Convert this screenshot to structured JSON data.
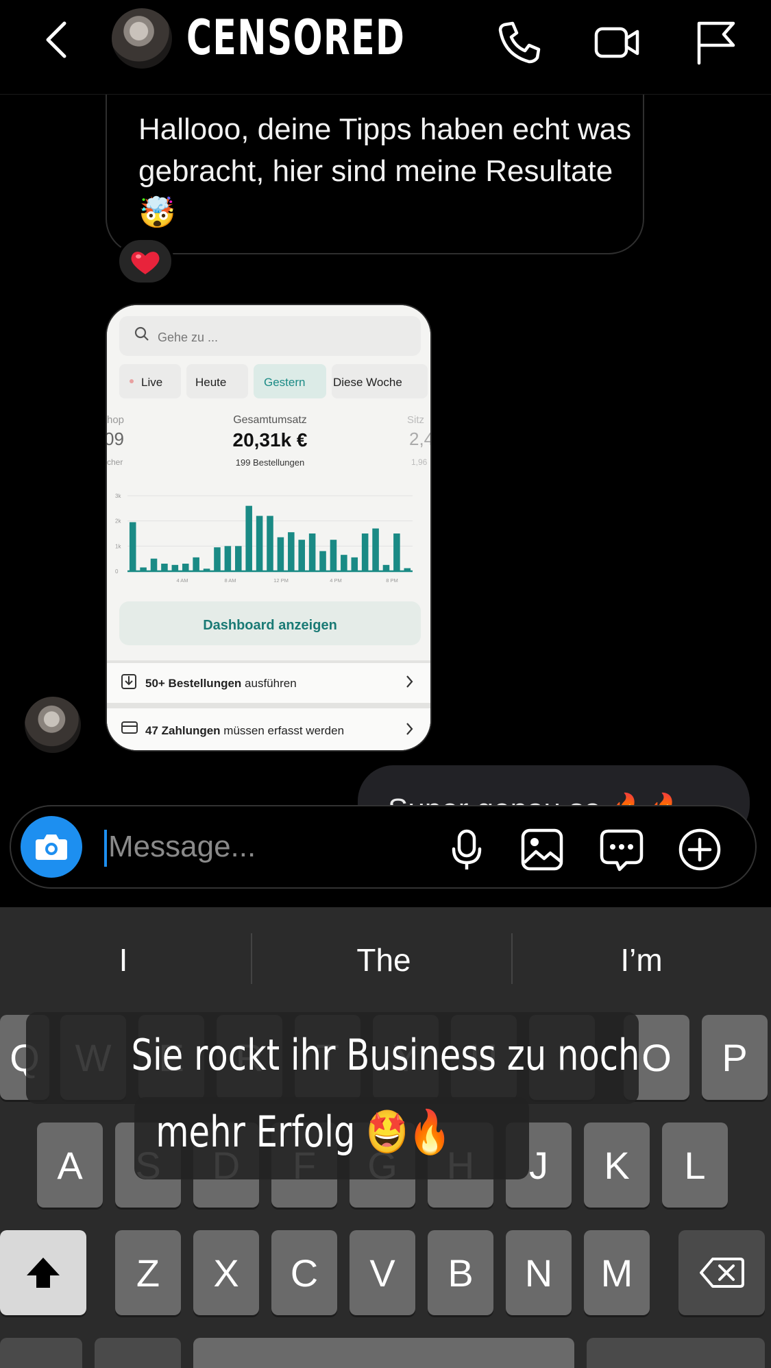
{
  "header": {
    "contact_name": "CENSORED",
    "icons": [
      "back-icon",
      "phone-icon",
      "video-icon",
      "flag-icon"
    ]
  },
  "messages": {
    "incoming_text": "Hallooo, deine Tipps haben echt was gebracht, hier sind meine Resultate 🤯",
    "reaction": "❤️",
    "outgoing_text_partial": "Super genau so 🔥🔥"
  },
  "shared_image": {
    "search_placeholder": "Gehe zu ...",
    "tabs": [
      "Live",
      "Heute",
      "Gestern",
      "Diese Woche"
    ],
    "active_tab": "Gestern",
    "left_metric": {
      "label": "hop",
      "value": "09",
      "sub": "cher"
    },
    "center_metric": {
      "label": "Gesamtumsatz",
      "value": "20,31k €",
      "sub": "199 Bestellungen"
    },
    "right_metric": {
      "label": "Sitz",
      "value": "2,4",
      "sub": "1,96"
    },
    "dashboard_button": "Dashboard anzeigen",
    "row1_bold": "50+ Bestellungen",
    "row1_rest": " ausführen",
    "row2_bold": "47 Zahlungen",
    "row2_rest": " müssen erfasst werden",
    "accent_color": "#1a8a85"
  },
  "chart_data": {
    "type": "bar",
    "ylabels": [
      "3k",
      "2k",
      "1k",
      "0"
    ],
    "xlabels": [
      "4 AM",
      "8 AM",
      "12 PM",
      "4 PM",
      "8 PM"
    ],
    "ylim": [
      0,
      3000
    ],
    "values": [
      1950,
      150,
      500,
      300,
      250,
      300,
      550,
      100,
      950,
      1000,
      1000,
      2600,
      2200,
      2200,
      1350,
      1550,
      1250,
      1500,
      800,
      1250,
      650,
      550,
      1500,
      1700,
      250,
      1500,
      120
    ],
    "color": "#1a8a85"
  },
  "composer": {
    "placeholder": "Message...",
    "icons": [
      "camera-icon",
      "microphone-icon",
      "gallery-icon",
      "sticker-icon",
      "plus-icon"
    ],
    "camera_color": "#1d8ff0"
  },
  "keyboard": {
    "suggestions": [
      "I",
      "The",
      "I’m"
    ],
    "row1": [
      "Q",
      "W",
      "E",
      "R",
      "T",
      "Y",
      "U",
      "I",
      "O",
      "P"
    ],
    "row2": [
      "A",
      "S",
      "D",
      "F",
      "G",
      "H",
      "J",
      "K",
      "L"
    ],
    "row3": [
      "Z",
      "X",
      "C",
      "V",
      "B",
      "N",
      "M"
    ]
  },
  "caption": {
    "line1": "Sie rockt ihr Business zu noch",
    "line2": "mehr Erfolg 🤩🔥"
  }
}
